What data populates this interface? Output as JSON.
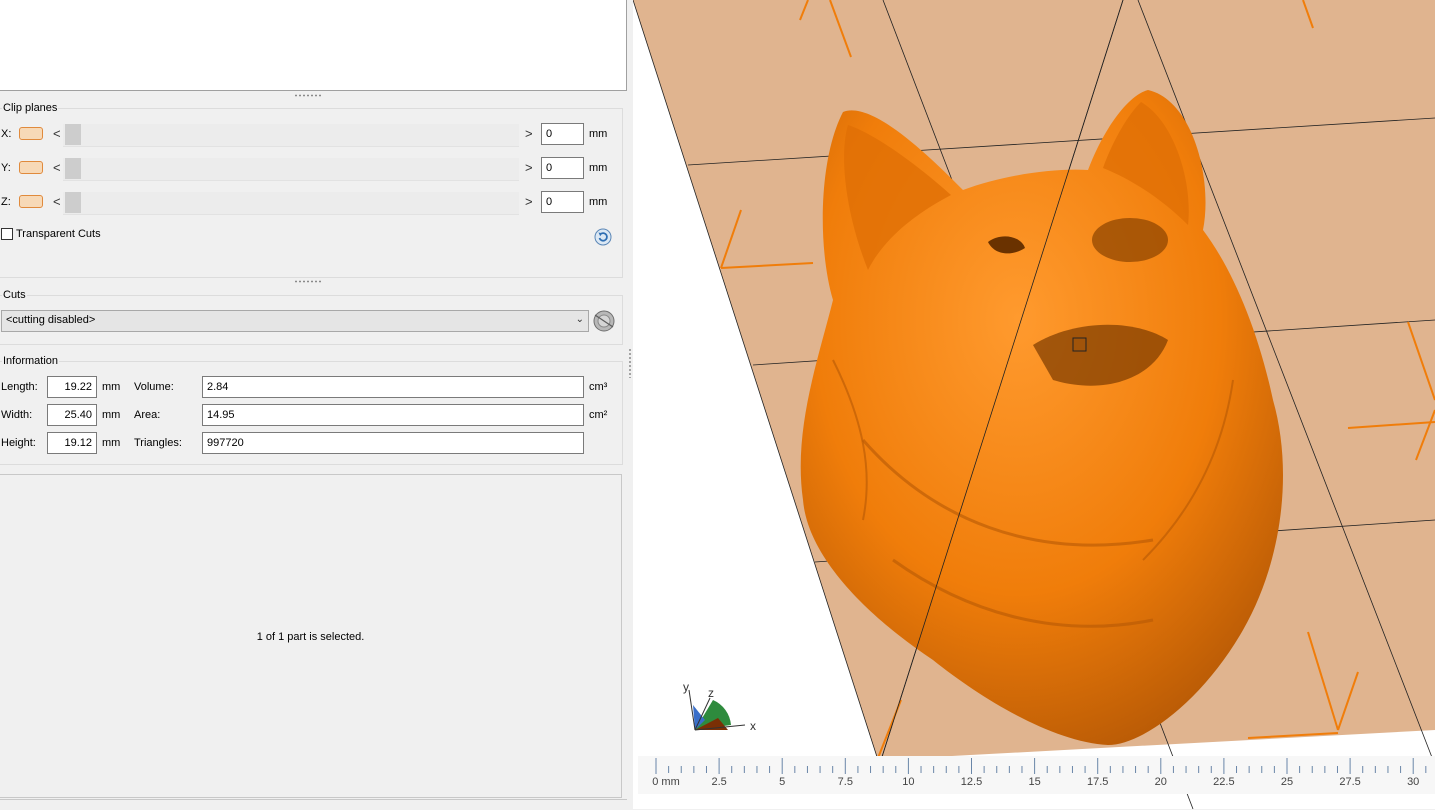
{
  "clip_planes": {
    "title": "Clip planes",
    "rows": [
      {
        "axis": "X:",
        "value": "0",
        "unit": "mm"
      },
      {
        "axis": "Y:",
        "value": "0",
        "unit": "mm"
      },
      {
        "axis": "Z:",
        "value": "0",
        "unit": "mm"
      }
    ],
    "arrow_left": "<",
    "arrow_right": ">",
    "transparent_cuts_label": "Transparent Cuts",
    "transparent_cuts_checked": false
  },
  "cuts": {
    "title": "Cuts",
    "selected": "<cutting disabled>"
  },
  "information": {
    "title": "Information",
    "length_label": "Length:",
    "length_value": "19.22",
    "width_label": "Width:",
    "width_value": "25.40",
    "height_label": "Height:",
    "height_value": "19.12",
    "dim_unit": "mm",
    "volume_label": "Volume:",
    "volume_value": "2.84",
    "volume_unit": "cm³",
    "area_label": "Area:",
    "area_value": "14.95",
    "area_unit": "cm²",
    "triangles_label": "Triangles:",
    "triangles_value": "997720"
  },
  "status": {
    "text": "1 of 1 part is selected."
  },
  "viewport": {
    "model_color": "#f07d0a",
    "plate_color": "#e0b48f",
    "axis_labels": {
      "x": "x",
      "y": "y",
      "z": "z"
    },
    "ruler_labels": [
      "0 mm",
      "2.5",
      "5",
      "7.5",
      "10",
      "12.5",
      "15",
      "17.5",
      "20",
      "22.5",
      "25",
      "27.5",
      "30"
    ]
  }
}
